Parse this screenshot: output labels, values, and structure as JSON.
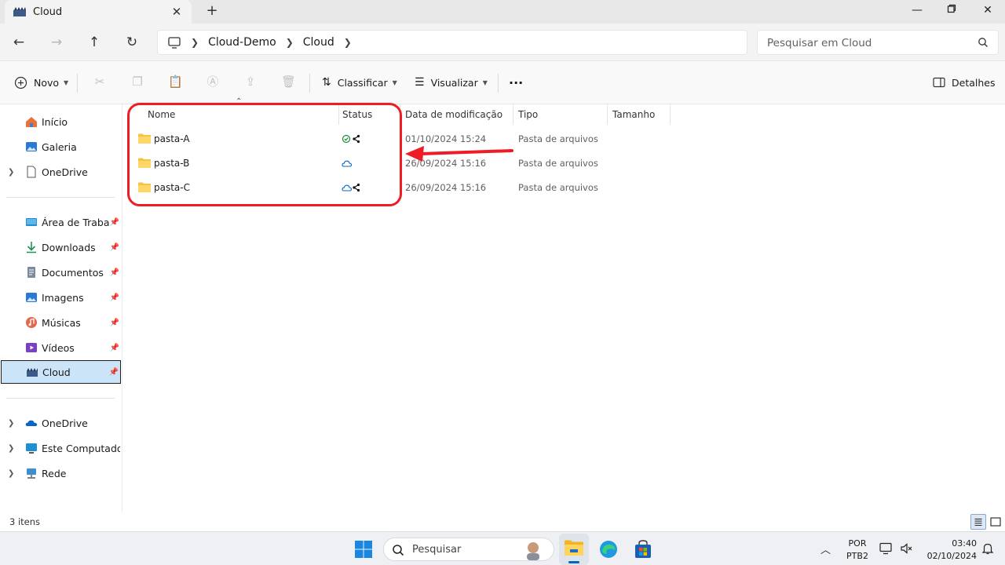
{
  "window": {
    "tab_title": "Cloud",
    "tab_close": "✕",
    "new_tab": "+"
  },
  "address": {
    "breadcrumb": [
      "Cloud-Demo",
      "Cloud"
    ],
    "search_placeholder": "Pesquisar em Cloud"
  },
  "commandbar": {
    "new_label": "Novo",
    "sort_label": "Classificar",
    "view_label": "Visualizar",
    "more_label": "···",
    "details_label": "Detalhes"
  },
  "sidebar": {
    "group1": [
      {
        "label": "Início",
        "icon": "home-icon"
      },
      {
        "label": "Galeria",
        "icon": "gallery-icon"
      },
      {
        "label": "OneDrive",
        "icon": "document-icon"
      }
    ],
    "group2": [
      {
        "label": "Área de Trabalho",
        "icon": "desktop-icon"
      },
      {
        "label": "Downloads",
        "icon": "download-icon"
      },
      {
        "label": "Documentos",
        "icon": "documents-icon"
      },
      {
        "label": "Imagens",
        "icon": "images-icon"
      },
      {
        "label": "Músicas",
        "icon": "music-icon"
      },
      {
        "label": "Vídeos",
        "icon": "video-icon"
      },
      {
        "label": "Cloud",
        "icon": "cloud-folder-icon"
      }
    ],
    "group3": [
      {
        "label": "OneDrive",
        "icon": "onedrive-icon"
      },
      {
        "label": "Este Computador",
        "icon": "computer-icon"
      },
      {
        "label": "Rede",
        "icon": "network-icon"
      }
    ]
  },
  "columns": [
    "Nome",
    "Status",
    "Data de modificação",
    "Tipo",
    "Tamanho"
  ],
  "files": [
    {
      "name": "pasta-A",
      "status": "synced-shared",
      "date": "01/10/2024 15:24",
      "type": "Pasta de arquivos"
    },
    {
      "name": "pasta-B",
      "status": "cloud",
      "date": "26/09/2024 15:16",
      "type": "Pasta de arquivos"
    },
    {
      "name": "pasta-C",
      "status": "cloud-shared",
      "date": "26/09/2024 15:16",
      "type": "Pasta de arquivos"
    }
  ],
  "statusbar": {
    "count": "3 itens"
  },
  "taskbar": {
    "search_label": "Pesquisar",
    "lang_top": "POR",
    "lang_bottom": "PTB2",
    "time": "03:40",
    "date": "02/10/2024"
  },
  "colors": {
    "accent": "#0067c0",
    "highlight": "#ee1c25",
    "folder": "#f5c242",
    "selected": "#cce4f7"
  }
}
